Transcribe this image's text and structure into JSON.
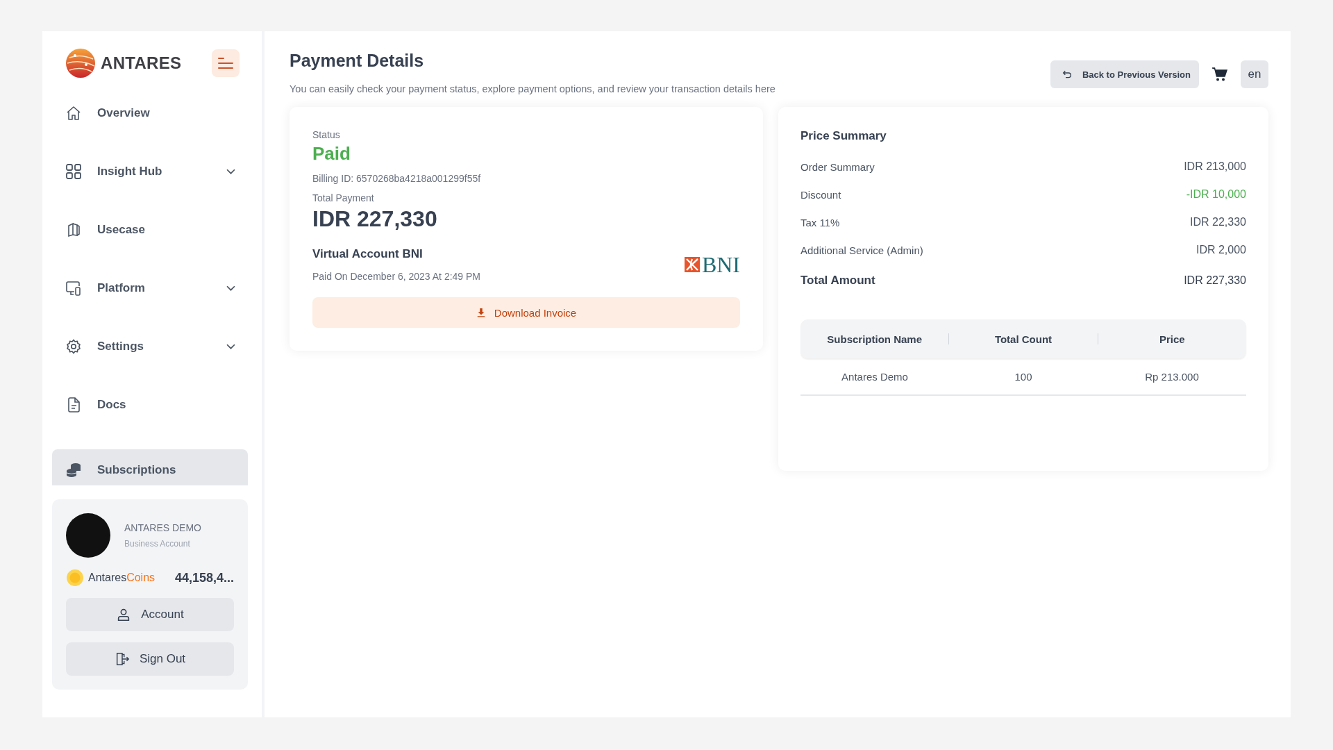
{
  "sidebar": {
    "logo_text": "ANTARES",
    "items": [
      {
        "label": "Overview",
        "selected": false
      },
      {
        "label": "Insight Hub",
        "selected": false,
        "expanded": false
      },
      {
        "label": "Usecase",
        "selected": false
      },
      {
        "label": "Platform",
        "selected": false,
        "expanded": false
      },
      {
        "label": "Settings",
        "selected": false,
        "expanded": false
      },
      {
        "label": "Docs",
        "selected": false
      },
      {
        "label": "Subscriptions",
        "selected": true
      }
    ],
    "profile": {
      "name": "ANTARES DEMO",
      "account_type": "Business Account",
      "coins_label": "Antares",
      "coins_label_accent": "Coins",
      "coins_value": "44,158,4...",
      "buttons": [
        "Account",
        "Sign Out"
      ]
    }
  },
  "header": {
    "title": "Payment Details",
    "subtitle": "You can easily check your payment status, explore payment options, and review your transaction details here",
    "back_button": "Back to Previous Version",
    "language": "en"
  },
  "payment_card": {
    "status_label": "Status",
    "status": "Paid",
    "billing_id": "Billing ID: 6570268ba4218a001299f55f",
    "total_label": "Total Payment",
    "total": "IDR 227,330",
    "method": "Virtual Account BNI",
    "paid_on": "Paid On December 6, 2023 At 2:49 PM",
    "bank_logo_text": "BNI",
    "download_button": "Download Invoice"
  },
  "price_summary": {
    "title": "Price Summary",
    "rows": [
      {
        "label": "Order Summary",
        "value": "IDR 213,000",
        "kind": "normal"
      },
      {
        "label": "Discount",
        "value": "-IDR 10,000",
        "kind": "discount"
      },
      {
        "label": "Tax 11%",
        "value": "IDR 22,330",
        "kind": "normal"
      },
      {
        "label": "Additional Service (Admin)",
        "value": "IDR 2,000",
        "kind": "normal"
      },
      {
        "label": "Total Amount",
        "value": "IDR 227,330",
        "kind": "total"
      }
    ],
    "table": {
      "columns": [
        "Subscription Name",
        "Total Count",
        "Price"
      ],
      "rows": [
        [
          "Antares Demo",
          "100",
          "Rp 213.000"
        ]
      ]
    }
  }
}
